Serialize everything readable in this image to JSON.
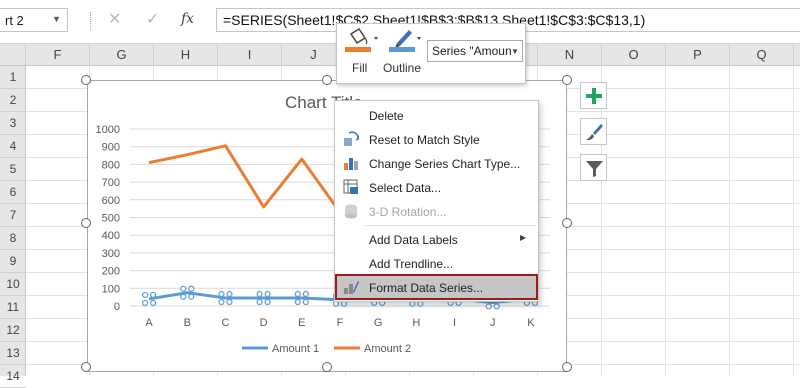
{
  "formula_bar": {
    "name_box": "rt 2",
    "fx_label": "fx",
    "formula": "=SERIES(Sheet1!$C$2,Sheet1!$B$3:$B$13,Sheet1!$C$3:$C$13,1)"
  },
  "columns": [
    "F",
    "G",
    "H",
    "I",
    "J",
    "K",
    "L",
    "M",
    "N",
    "O",
    "P",
    "Q"
  ],
  "rows": [
    "1",
    "2",
    "3",
    "4",
    "5",
    "6",
    "7",
    "8",
    "9",
    "10",
    "11",
    "12",
    "13",
    "14"
  ],
  "mini_toolbar": {
    "fill_label": "Fill",
    "outline_label": "Outline",
    "series_select": "Series \"Amoun"
  },
  "context_menu": {
    "items": [
      {
        "label": "Delete",
        "icon": "none"
      },
      {
        "label": "Reset to Match Style",
        "icon": "reset-style-icon"
      },
      {
        "label": "Change Series Chart Type...",
        "icon": "chart-type-icon"
      },
      {
        "label": "Select Data...",
        "icon": "select-data-icon"
      },
      {
        "label": "3-D Rotation...",
        "icon": "3d-rotation-icon",
        "disabled": true
      },
      {
        "label": "Add Data Labels",
        "icon": "none",
        "submenu": true
      },
      {
        "label": "Add Trendline...",
        "icon": "none"
      },
      {
        "label": "Format Data Series...",
        "icon": "format-series-icon",
        "highlighted": true
      }
    ]
  },
  "chart": {
    "title": "Chart Title"
  },
  "chart_data": {
    "type": "line",
    "title": "Chart Title",
    "categories": [
      "A",
      "B",
      "C",
      "D",
      "E",
      "F",
      "G",
      "H",
      "I",
      "J",
      "K"
    ],
    "series": [
      {
        "name": "Amount 1",
        "color": "#5b9bd5",
        "values": [
          40,
          75,
          45,
          45,
          45,
          35,
          40,
          35,
          40,
          20,
          40
        ]
      },
      {
        "name": "Amount 2",
        "color": "#ed7d31",
        "values": [
          810,
          855,
          905,
          560,
          830,
          530,
          null,
          null,
          null,
          null,
          null
        ]
      }
    ],
    "ylim": [
      0,
      1000
    ],
    "yticks": [
      0,
      100,
      200,
      300,
      400,
      500,
      600,
      700,
      800,
      900,
      1000
    ],
    "grid": true,
    "legend": "bottom"
  },
  "colors": {
    "accent_green": "#22a366",
    "highlight_border": "#9b1c1c",
    "fill_swatch": "#ed7d31",
    "outline_swatch": "#5b9bd5"
  }
}
